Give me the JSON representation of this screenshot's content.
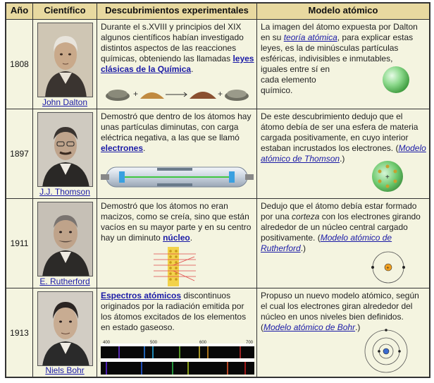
{
  "header": {
    "year": "Año",
    "scientist": "Científico",
    "discoveries": "Descubrimientos experimentales",
    "model": "Modelo atómico"
  },
  "rows": [
    {
      "year": "1808",
      "scientist": "John Dalton",
      "disc_text": "Durante el s.XVIII y principios del XIX algunos científicos habían investigado distintos aspectos de las reacciones químicas, obteniendo las llamadas",
      "disc_link": "leyes clásicas de la Química",
      "disc_after": ".",
      "model_pre": "La imagen del átomo expuesta por Dalton en su",
      "model_link": "teoría atómica",
      "model_post": ", para explicar estas leyes, es la de minúsculas partículas esféricas, indivisibles e inmutables,",
      "model_tail": "iguales entre sí en cada elemento químico."
    },
    {
      "year": "1897",
      "scientist": "J.J. Thomson",
      "disc_text": "Demostró que dentro de los átomos hay unas partículas diminutas, con carga eléctrica negativa, a las que se llamó",
      "disc_link": "electrones",
      "disc_after": ".",
      "model_text": "De este descubrimiento dedujo que el átomo debía de ser una esfera de materia cargada positivamente, en cuyo interior estaban incrustados los electrones.",
      "model_link_open": "(",
      "model_link": "Modelo atómico de Thomson",
      "model_link_close": ".)"
    },
    {
      "year": "1911",
      "scientist": "E. Rutherford",
      "disc_text": "Demostró que los átomos no eran macizos, como se creía, sino que están vacíos en su mayor parte y en su centro hay un diminuto",
      "disc_link": "núcleo",
      "disc_after": ".",
      "model_pre": "Dedujo que el átomo debía estar formado por una",
      "model_italic": "corteza",
      "model_post": "con los electrones girando alrededor de un núcleo central cargado positivamente.",
      "model_link_open": "(",
      "model_link": "Modelo atómico de Rutherford",
      "model_link_close": ".)"
    },
    {
      "year": "1913",
      "scientist": "Niels Bohr",
      "disc_link": "Espectros atómicos",
      "disc_text": "discontinuos originados por la radiación emitida por los átomos excitados de los elementos en estado gaseoso.",
      "spectrum_ticks": [
        "400",
        "500",
        "600",
        "700"
      ],
      "model_text": "Propuso un nuevo modelo atómico, según el cual los electrones giran alrededor del núcleo en unos niveles bien definidos.",
      "model_link_open": "(",
      "model_link": "Modelo atómico de Bohr",
      "model_link_close": ".)"
    }
  ],
  "colors": {
    "header_bg": "#e8d9a0",
    "cell_bg": "#f4f4e0",
    "link": "#1a1aa6",
    "thomson_sphere": "#6cc86c",
    "dalton_sphere": "#8cd98c"
  }
}
